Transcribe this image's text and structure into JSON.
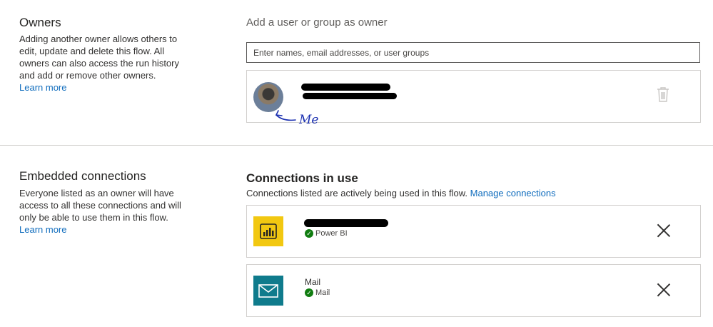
{
  "owners": {
    "title": "Owners",
    "description": "Adding another owner allows others to edit, update and delete this flow. All owners can also access the run history and add or remove other owners.",
    "learn_more": "Learn more",
    "add_heading": "Add a user or group as owner",
    "input_placeholder": "Enter names, email addresses, or user groups",
    "owner_card": {
      "annotation": "Me",
      "icon": "trash-icon"
    }
  },
  "embedded": {
    "title": "Embedded connections",
    "description": "Everyone listed as an owner will have access to all these connections and will only be able to use them in this flow.",
    "learn_more": "Learn more",
    "connections_heading": "Connections in use",
    "connections_subtext": "Connections listed are actively being used in this flow.",
    "manage_link": "Manage connections",
    "connections": [
      {
        "name": "",
        "service": "Power BI",
        "icon": "power-bi-icon",
        "color": "#F2C811"
      },
      {
        "name": "Mail",
        "service": "Mail",
        "icon": "mail-icon",
        "color": "#0F7B8C"
      }
    ]
  },
  "colors": {
    "link": "#0f6cbd",
    "status_ok": "#107c10",
    "annotation": "#1a2fb0"
  }
}
